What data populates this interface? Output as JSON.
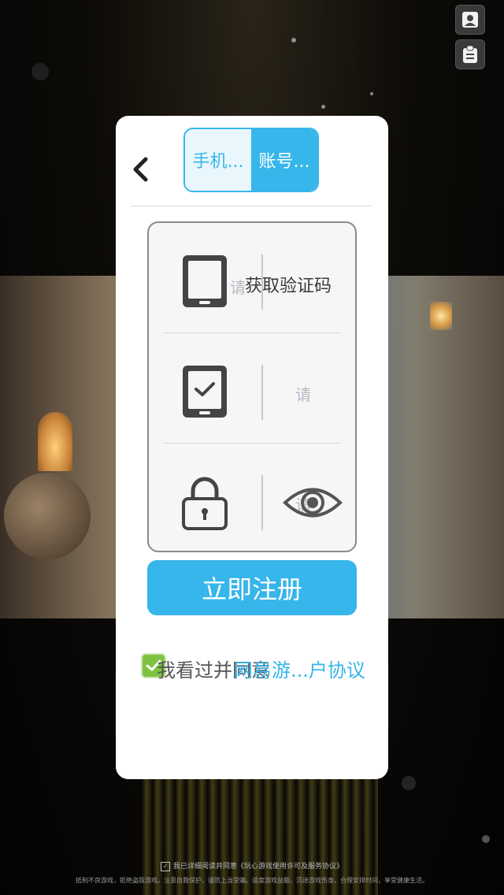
{
  "dialog": {
    "tabs": [
      {
        "label": "手机..."
      },
      {
        "label": "账号..."
      }
    ],
    "phone_placeholder": "请",
    "get_code_label": "获取验证码",
    "code_placeholder": "请",
    "password_placeholder": "请",
    "register_label": "立即注册",
    "agree_text": "我看过并同意",
    "agree_link": "网易游...户协议"
  },
  "footer": {
    "line1": "我已详细阅读并同意《玩心游戏使用许可及服务协议》",
    "line2": "抵制不良游戏，拒绝盗版游戏。注意自我保护，谨防上当受骗。适度游戏益脑，沉迷游戏伤身。合理安排时间，享受健康生活。"
  },
  "icons": {
    "top_user": "user-icon",
    "top_notice": "notice-icon",
    "back": "chevron-left-icon",
    "phone": "phone-icon",
    "verify": "verify-phone-icon",
    "lock": "lock-icon",
    "eye": "eye-icon",
    "check": "check-icon"
  },
  "colors": {
    "accent": "#36b6ea",
    "check": "#7ec242"
  }
}
